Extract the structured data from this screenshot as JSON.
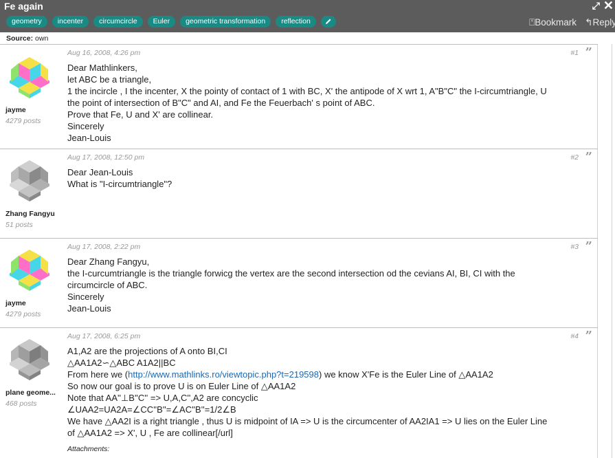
{
  "header": {
    "title": "Fe again",
    "tags": [
      "geometry",
      "incenter",
      "circumcircle",
      "Euler",
      "geometric transformation",
      "reflection"
    ],
    "bookmark_label": "Bookmark",
    "reply_label": "Reply",
    "expand_icon": "expand-icon",
    "close_icon": "close-icon"
  },
  "source": {
    "label": "Source:",
    "value": "own"
  },
  "colors": {
    "header_bg": "#5c5c5c",
    "tag_bg": "#1a8a84",
    "link": "#1a68b5"
  },
  "posts": [
    {
      "username": "jayme",
      "post_count": "4279 posts",
      "date": "Aug 16, 2008, 4:26 pm",
      "number": "#1",
      "avatar": "colorful",
      "lines": [
        "Dear Mathlinkers,",
        "let ABC be a triangle,",
        "1 the incircle , I the incenter, X the pointy of contact of 1 with BC, X' the antipode of X wrt 1, A\"B\"C\" the I-circumtriangle, U",
        "the point of intersection of B\"C\" and AI, and Fe the Feuerbach' s point of ABC.",
        "Prove that Fe, U and X' are collinear.",
        "Sincerely",
        "Jean-Louis"
      ]
    },
    {
      "username": "Zhang Fangyu",
      "post_count": "51 posts",
      "date": "Aug 17, 2008, 12:50 pm",
      "number": "#2",
      "avatar": "gray",
      "lines": [
        "Dear Jean-Louis",
        "What is \"I-circumtriangle\"?"
      ]
    },
    {
      "username": "jayme",
      "post_count": "4279 posts",
      "date": "Aug 17, 2008, 2:22 pm",
      "number": "#3",
      "avatar": "colorful",
      "lines": [
        "Dear Zhang Fangyu,",
        "the I-curcumtriangle is the triangle forwicg the vertex are the second intersection od the cevians AI, BI, CI with the",
        "circumcircle of ABC.",
        "Sincerely",
        "Jean-Louis"
      ]
    },
    {
      "username": "plane geome...",
      "post_count": "468 posts",
      "date": "Aug 17, 2008, 6:25 pm",
      "number": "#4",
      "avatar": "gray",
      "lines": [
        "A1,A2 are the projections of A onto BI,CI",
        "△AA1A2∽△ABC A1A2||BC",
        "From here we (",
        "So now our goal is to prove U is on Euler Line of △AA1A2",
        "Note that AA''⊥B''C'' => U,A,C'',A2 are concyclic",
        "∠UAA2=UA2A=∠CC''B''=∠AC''B''=1/2∠B",
        "We have △AA2I is a right triangle , thus U is midpoint of IA => U is the circumcenter of AA2IA1 => U lies on the Euler Line",
        "of △AA1A2 => X', U , Fe are collinear[/url]"
      ],
      "link_text": "http://www.mathlinks.ro/viewtopic.php?t=219598",
      "link_after": ") we know X'Fe is the Euler Line of △AA1A2",
      "attachments_label": "Attachments:"
    }
  ]
}
